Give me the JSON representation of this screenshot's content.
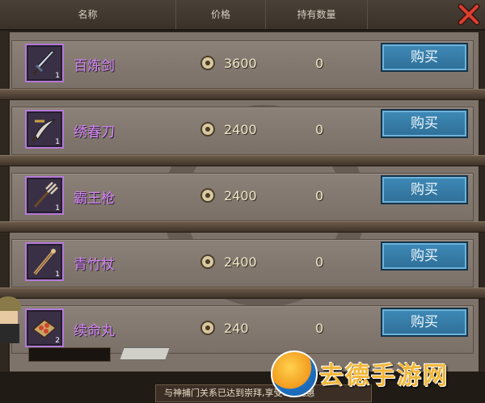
{
  "header": {
    "col_name": "名称",
    "col_price": "价格",
    "col_owned": "持有数量"
  },
  "items": [
    {
      "name": "百炼剑",
      "price": "3600",
      "owned": "0",
      "qty": "1",
      "icon": "sword-icon",
      "button": "购买"
    },
    {
      "name": "绣春刀",
      "price": "2400",
      "owned": "0",
      "qty": "1",
      "icon": "sabre-icon",
      "button": "购买"
    },
    {
      "name": "霸王枪",
      "price": "2400",
      "owned": "0",
      "qty": "1",
      "icon": "trident-icon",
      "button": "购买"
    },
    {
      "name": "青竹杖",
      "price": "2400",
      "owned": "0",
      "qty": "1",
      "icon": "staff-icon",
      "button": "购买"
    },
    {
      "name": "续命丸",
      "price": "240",
      "owned": "0",
      "qty": "2",
      "icon": "pill-box-icon",
      "button": "购买"
    }
  ],
  "notice": "与神捕门关系已达到崇拜,享受8折优惠",
  "watermark": "去德手游网",
  "colors": {
    "item_name": "#d487f0",
    "buy_button": "#3f8ab8",
    "close": "#d9402f"
  }
}
